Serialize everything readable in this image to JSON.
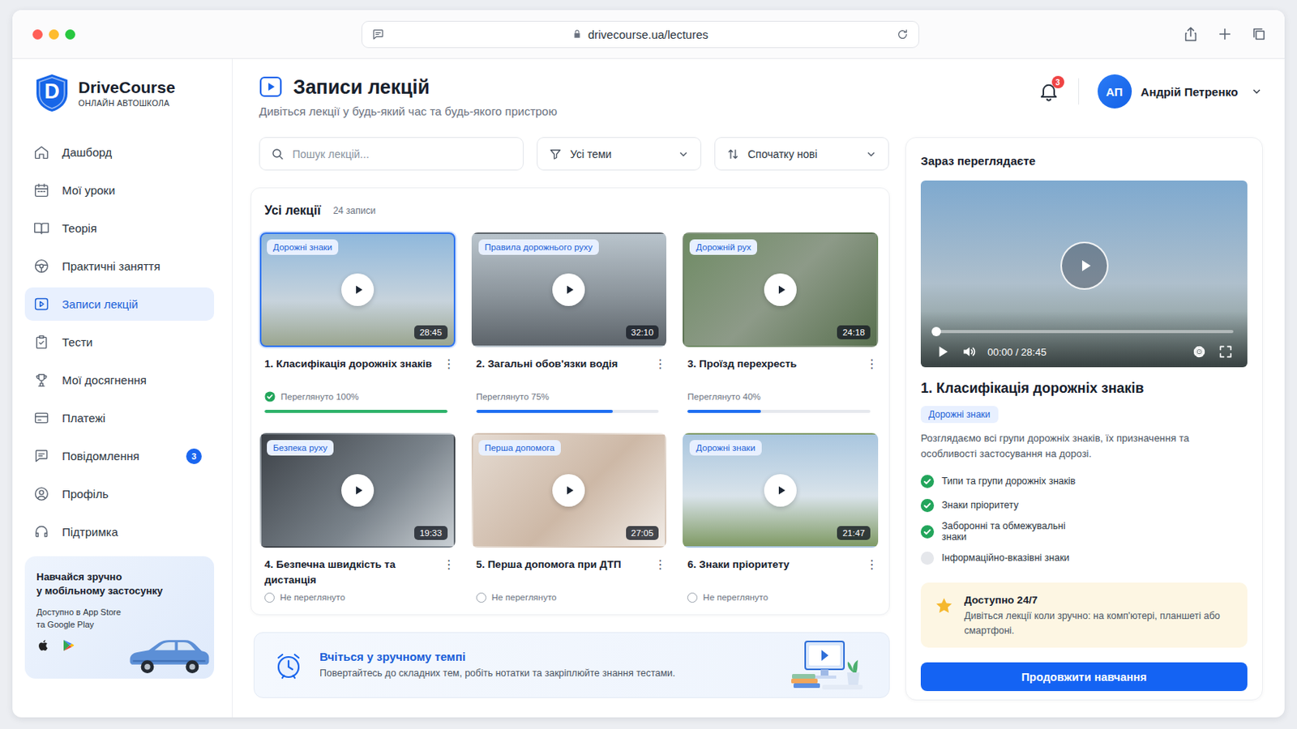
{
  "browser": {
    "url": "drivecourse.ua/lectures"
  },
  "brand": {
    "logo": "D",
    "name": "DriveCourse",
    "subtitle": "ОНЛАЙН АВТОШКОЛА"
  },
  "sidebar": {
    "items": [
      {
        "label": "Дашборд",
        "selected": false,
        "badge": null
      },
      {
        "label": "Мої уроки",
        "selected": false,
        "badge": null
      },
      {
        "label": "Теорія",
        "selected": false,
        "badge": null
      },
      {
        "label": "Практичні заняття",
        "selected": false,
        "badge": null
      },
      {
        "label": "Записи лекцій",
        "selected": true,
        "badge": null
      },
      {
        "label": "Тести",
        "selected": false,
        "badge": null
      },
      {
        "label": "Мої досягнення",
        "selected": false,
        "badge": null
      },
      {
        "label": "Платежі",
        "selected": false,
        "badge": null
      },
      {
        "label": "Повідомлення",
        "selected": false,
        "badge": "3"
      },
      {
        "label": "Профіль",
        "selected": false,
        "badge": null
      },
      {
        "label": "Підтримка",
        "selected": false,
        "badge": null
      }
    ]
  },
  "promo": {
    "title": [
      "Навчайся зручно",
      "у мобільному застосунку"
    ],
    "text": [
      "Доступно в App Store",
      "та Google Play"
    ]
  },
  "header": {
    "title": "Записи лекцій",
    "subtitle": "Дивіться лекції у будь-який час та будь-якого пристрою",
    "notifications": "3",
    "user": {
      "initials": "АП",
      "name": "Андрій Петренко"
    }
  },
  "filters": {
    "search_placeholder": "Пошук лекцій...",
    "topic": "Усі теми",
    "sort": "Спочатку нові"
  },
  "lectures": {
    "title": "Усі лекції",
    "count": "24 записи",
    "menu_icon": "⋮",
    "items": [
      {
        "tag": "Дорожні знаки",
        "duration": "28:45",
        "title": "1. Класифікація дорожніх знаків",
        "status": "Переглянуто 100%",
        "kind": "done",
        "level": 1,
        "selected": true
      },
      {
        "tag": "Правила дорожнього руху",
        "duration": "32:10",
        "title": "2. Загальні обов'язки водія",
        "status": "Переглянуто 75%",
        "kind": "progress",
        "level": 0.75,
        "selected": false
      },
      {
        "tag": "Дорожній рух",
        "duration": "24:18",
        "title": "3. Проїзд перехресть",
        "status": "Переглянуто 40%",
        "kind": "progress",
        "level": 0.4,
        "selected": false
      },
      {
        "tag": "Безпека руху",
        "duration": "19:33",
        "title": "4. Безпечна швидкість та дистанція",
        "status": "Не переглянуто",
        "kind": "new",
        "selected": false
      },
      {
        "tag": "Перша допомога",
        "duration": "27:05",
        "title": "5. Перша допомога при ДТП",
        "status": "Не переглянуто",
        "kind": "new",
        "selected": false
      },
      {
        "tag": "Дорожні знаки",
        "duration": "21:47",
        "title": "6. Знаки пріоритету",
        "status": "Не переглянуто",
        "kind": "new",
        "selected": false
      }
    ]
  },
  "tip": {
    "title": "Вчіться у зручному темпі",
    "text": "Повертайтесь до складних тем, робіть нотатки та закріплюйте знання тестами."
  },
  "now_playing": {
    "heading": "Зараз переглядаєте",
    "time": "00:00 / 28:45",
    "level": 0,
    "title": "1. Класифікація дорожніх знаків",
    "tag": "Дорожні знаки",
    "description": "Розглядаємо всі групи дорожніх знаків, їх призначення та особливості застосування на дорозі.",
    "topics": [
      {
        "label": "Типи та групи дорожніх знаків",
        "done": true
      },
      {
        "label": "Знаки пріоритету",
        "done": true
      },
      {
        "label": "Заборонні та обмежувальні знаки",
        "done": true
      },
      {
        "label": "Інформаційно-вказівні знаки",
        "done": false
      }
    ],
    "note": {
      "title": "Доступно 24/7",
      "text": "Дивіться лекції коли зручно: на комп'ютері, планшеті або смартфоні."
    },
    "button": "Продовжити навчання"
  }
}
